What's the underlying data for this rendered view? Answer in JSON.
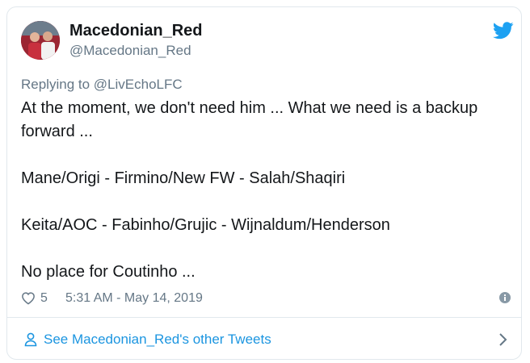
{
  "author": {
    "display_name": "Macedonian_Red",
    "handle": "@Macedonian_Red"
  },
  "reply": {
    "prefix": "Replying to ",
    "to_handle": "@LivEchoLFC"
  },
  "tweet": {
    "paragraphs": [
      "At the moment, we don't need him ... What we need is a backup forward ...",
      "Mane/Origi - Firmino/New FW - Salah/Shaqiri",
      "Keita/AOC - Fabinho/Grujic - Wijnaldum/Henderson",
      "No place for Coutinho ..."
    ]
  },
  "meta": {
    "like_count": "5",
    "timestamp": "5:31 AM - May 14, 2019"
  },
  "footer": {
    "link_text": "See Macedonian_Red's other Tweets"
  },
  "colors": {
    "twitter_blue": "#1da1f2",
    "link_blue": "#1b95e0",
    "secondary_text": "#657786",
    "primary_text": "#14171a",
    "border": "#e1e8ed"
  },
  "icons": {
    "logo": "twitter-bird-icon",
    "like": "heart-outline-icon",
    "info": "info-circle-icon",
    "profile": "person-icon",
    "chevron": "chevron-right-icon"
  }
}
